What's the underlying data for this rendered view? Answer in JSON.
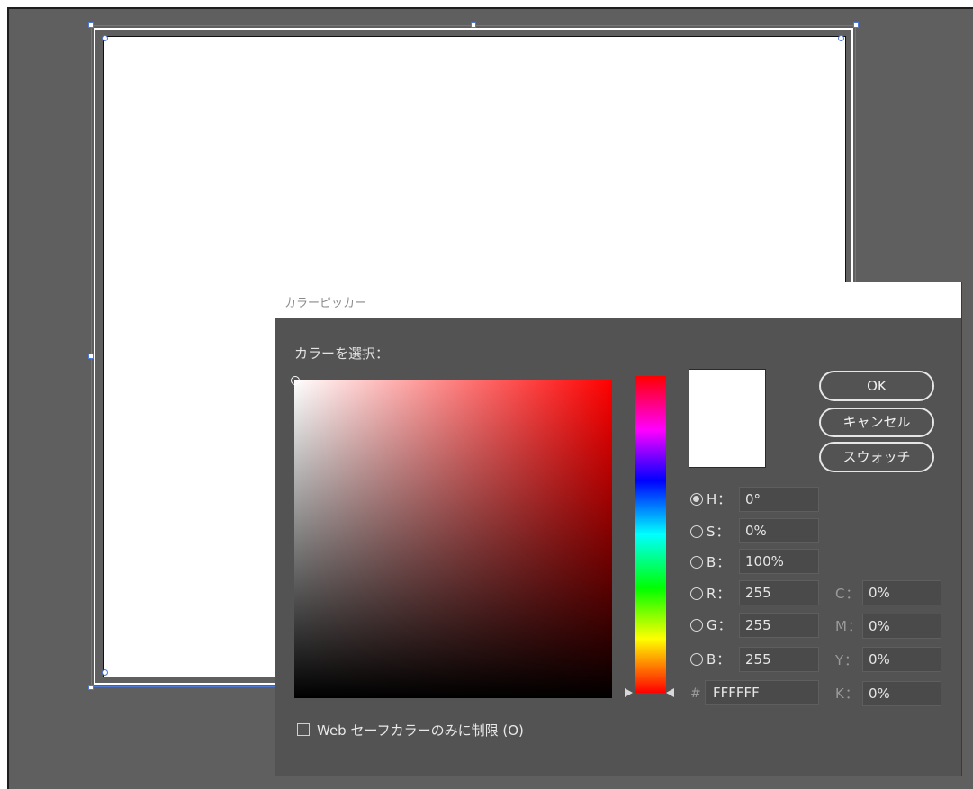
{
  "dialog": {
    "title": "カラーピッカー",
    "select_label": "カラーを選択：",
    "buttons": {
      "ok": "OK",
      "cancel": "キャンセル",
      "swatches": "スウォッチ"
    },
    "fields": {
      "h": {
        "label": "H：",
        "value": "0°",
        "selected": true
      },
      "s": {
        "label": "S：",
        "value": "0%"
      },
      "b": {
        "label": "B：",
        "value": "100%"
      },
      "r": {
        "label": "R：",
        "value": "255"
      },
      "g": {
        "label": "G：",
        "value": "255"
      },
      "b2": {
        "label": "B：",
        "value": "255"
      },
      "hex": {
        "label": "#",
        "value": "FFFFFF"
      }
    },
    "cmyk": {
      "c": {
        "label": "C：",
        "value": "0%"
      },
      "m": {
        "label": "M：",
        "value": "0%"
      },
      "y": {
        "label": "Y：",
        "value": "0%"
      },
      "k": {
        "label": "K：",
        "value": "0%"
      }
    },
    "web_safe_label": "Web セーフカラーのみに制限 (O)",
    "current_color": "#FFFFFF"
  }
}
